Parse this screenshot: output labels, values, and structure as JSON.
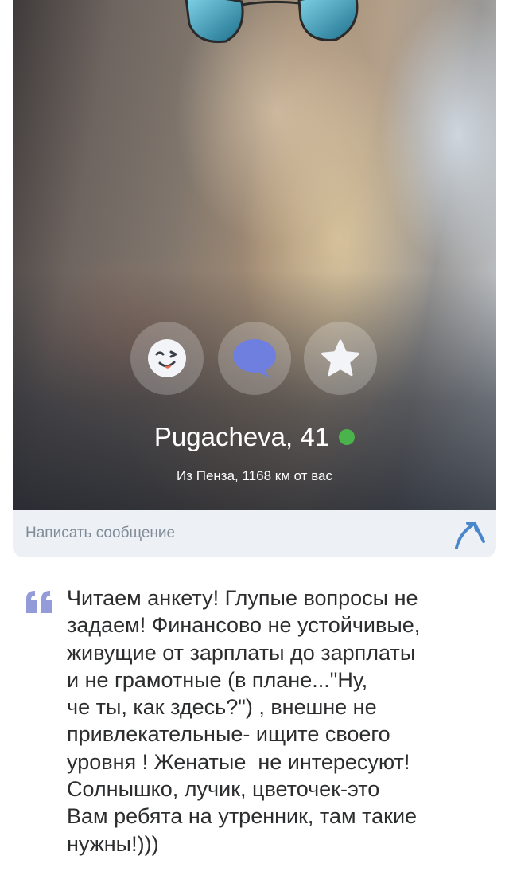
{
  "profile": {
    "name_age": "Pugacheva, 41",
    "online": true,
    "location": "Из Пенза, 1168 км от вас"
  },
  "actions": [
    {
      "icon": "wink-smiley-icon"
    },
    {
      "icon": "chat-bubble-icon"
    },
    {
      "icon": "star-icon"
    }
  ],
  "message": {
    "placeholder": "Написать сообщение",
    "send_icon": "send-arrow-icon"
  },
  "about": {
    "icon": "quote-icon",
    "text": "Читаем анкету! Глупые вопросы не\nзадаем! Финансово не устойчивые,\nживущие от зарплаты до зарплаты\nи не грамотные (в плане...\"Ну,\nче ты, как здесь?\") , внешне не\nпривлекательные- ищите своего\nуровня ! Женатые  не интересуют!\nСолнышко, лучик, цветочек-это\nВам ребята на утренник, там такие\nнужны!)))"
  },
  "colors": {
    "accent": "#4986cc",
    "online": "#4bb34b",
    "quote": "#939bd9",
    "chat_bubble": "#6f7fe0",
    "placeholder": "#818c99",
    "text": "#2c2d2e"
  }
}
